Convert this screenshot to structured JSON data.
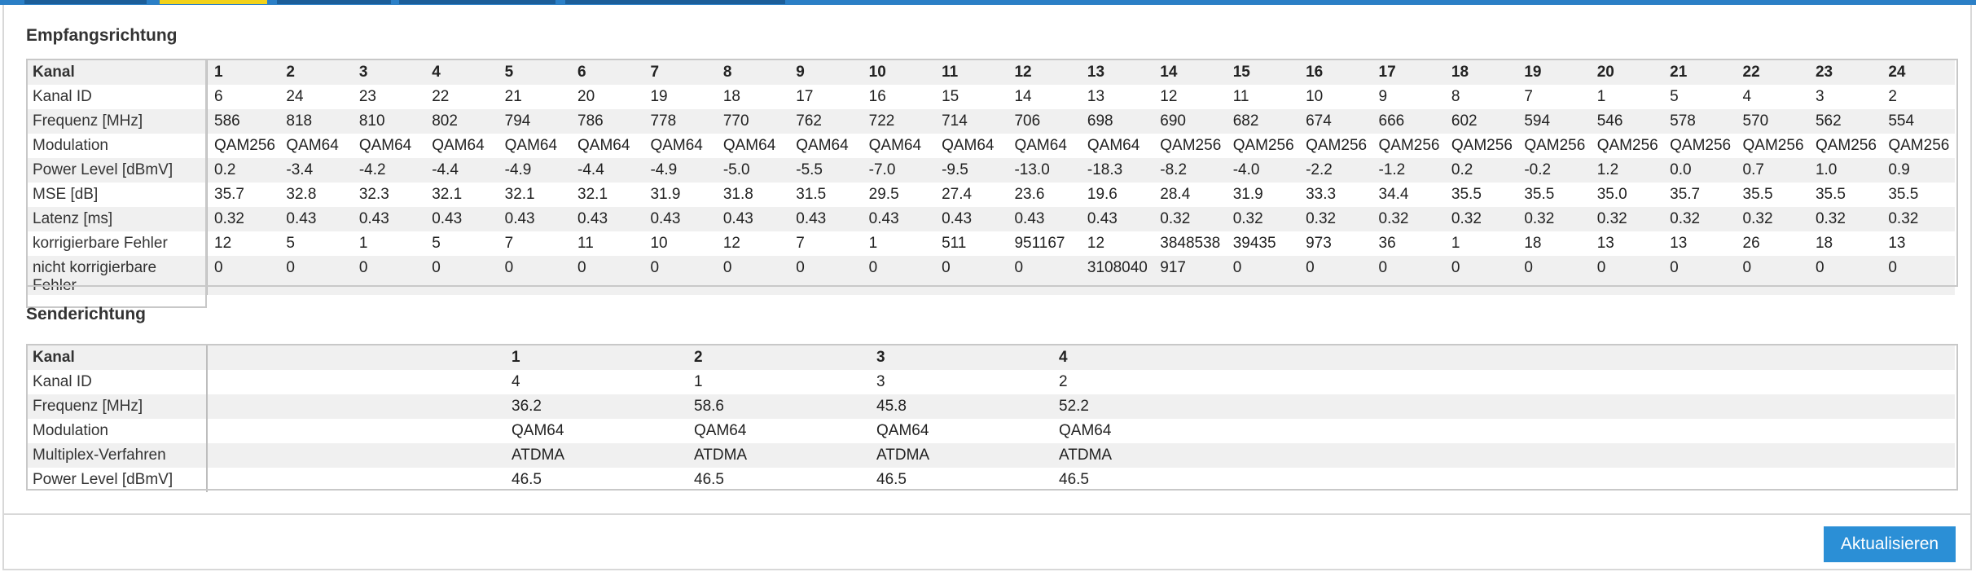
{
  "downstream": {
    "title": "Empfangsrichtung",
    "channel_header": "Kanal",
    "channels": [
      "1",
      "2",
      "3",
      "4",
      "5",
      "6",
      "7",
      "8",
      "9",
      "10",
      "11",
      "12",
      "13",
      "14",
      "15",
      "16",
      "17",
      "18",
      "19",
      "20",
      "21",
      "22",
      "23",
      "24"
    ],
    "rows": [
      {
        "label": "Kanal ID",
        "values": [
          "6",
          "24",
          "23",
          "22",
          "21",
          "20",
          "19",
          "18",
          "17",
          "16",
          "15",
          "14",
          "13",
          "12",
          "11",
          "10",
          "9",
          "8",
          "7",
          "1",
          "5",
          "4",
          "3",
          "2"
        ]
      },
      {
        "label": "Frequenz [MHz]",
        "values": [
          "586",
          "818",
          "810",
          "802",
          "794",
          "786",
          "778",
          "770",
          "762",
          "722",
          "714",
          "706",
          "698",
          "690",
          "682",
          "674",
          "666",
          "602",
          "594",
          "546",
          "578",
          "570",
          "562",
          "554"
        ]
      },
      {
        "label": "Modulation",
        "values": [
          "QAM256",
          "QAM64",
          "QAM64",
          "QAM64",
          "QAM64",
          "QAM64",
          "QAM64",
          "QAM64",
          "QAM64",
          "QAM64",
          "QAM64",
          "QAM64",
          "QAM64",
          "QAM256",
          "QAM256",
          "QAM256",
          "QAM256",
          "QAM256",
          "QAM256",
          "QAM256",
          "QAM256",
          "QAM256",
          "QAM256",
          "QAM256"
        ]
      },
      {
        "label": "Power Level [dBmV]",
        "values": [
          "0.2",
          "-3.4",
          "-4.2",
          "-4.4",
          "-4.9",
          "-4.4",
          "-4.9",
          "-5.0",
          "-5.5",
          "-7.0",
          "-9.5",
          "-13.0",
          "-18.3",
          "-8.2",
          "-4.0",
          "-2.2",
          "-1.2",
          "0.2",
          "-0.2",
          "1.2",
          "0.0",
          "0.7",
          "1.0",
          "0.9"
        ]
      },
      {
        "label": "MSE [dB]",
        "values": [
          "35.7",
          "32.8",
          "32.3",
          "32.1",
          "32.1",
          "32.1",
          "31.9",
          "31.8",
          "31.5",
          "29.5",
          "27.4",
          "23.6",
          "19.6",
          "28.4",
          "31.9",
          "33.3",
          "34.4",
          "35.5",
          "35.5",
          "35.0",
          "35.7",
          "35.5",
          "35.5",
          "35.5"
        ]
      },
      {
        "label": "Latenz [ms]",
        "values": [
          "0.32",
          "0.43",
          "0.43",
          "0.43",
          "0.43",
          "0.43",
          "0.43",
          "0.43",
          "0.43",
          "0.43",
          "0.43",
          "0.43",
          "0.43",
          "0.32",
          "0.32",
          "0.32",
          "0.32",
          "0.32",
          "0.32",
          "0.32",
          "0.32",
          "0.32",
          "0.32",
          "0.32"
        ]
      },
      {
        "label": "korrigierbare Fehler",
        "values": [
          "12",
          "5",
          "1",
          "5",
          "7",
          "11",
          "10",
          "12",
          "7",
          "1",
          "511",
          "951167",
          "12",
          "3848538",
          "39435",
          "973",
          "36",
          "1",
          "18",
          "13",
          "13",
          "26",
          "18",
          "13"
        ]
      },
      {
        "label": "nicht korrigierbare Fehler",
        "values": [
          "0",
          "0",
          "0",
          "0",
          "0",
          "0",
          "0",
          "0",
          "0",
          "0",
          "0",
          "0",
          "3108040",
          "917",
          "0",
          "0",
          "0",
          "0",
          "0",
          "0",
          "0",
          "0",
          "0",
          "0"
        ]
      }
    ]
  },
  "upstream": {
    "title": "Senderichtung",
    "channel_header": "Kanal",
    "channels": [
      "1",
      "2",
      "3",
      "4"
    ],
    "rows": [
      {
        "label": "Kanal ID",
        "values": [
          "4",
          "1",
          "3",
          "2"
        ]
      },
      {
        "label": "Frequenz [MHz]",
        "values": [
          "36.2",
          "58.6",
          "45.8",
          "52.2"
        ]
      },
      {
        "label": "Modulation",
        "values": [
          "QAM64",
          "QAM64",
          "QAM64",
          "QAM64"
        ]
      },
      {
        "label": "Multiplex-Verfahren",
        "values": [
          "ATDMA",
          "ATDMA",
          "ATDMA",
          "ATDMA"
        ]
      },
      {
        "label": "Power Level [dBmV]",
        "values": [
          "46.5",
          "46.5",
          "46.5",
          "46.5"
        ]
      }
    ]
  },
  "actions": {
    "refresh_label": "Aktualisieren"
  },
  "colors": {
    "accent": "#2b8fd6",
    "topbar": "#2b7fc6",
    "active_tab": "#f2d21b"
  }
}
